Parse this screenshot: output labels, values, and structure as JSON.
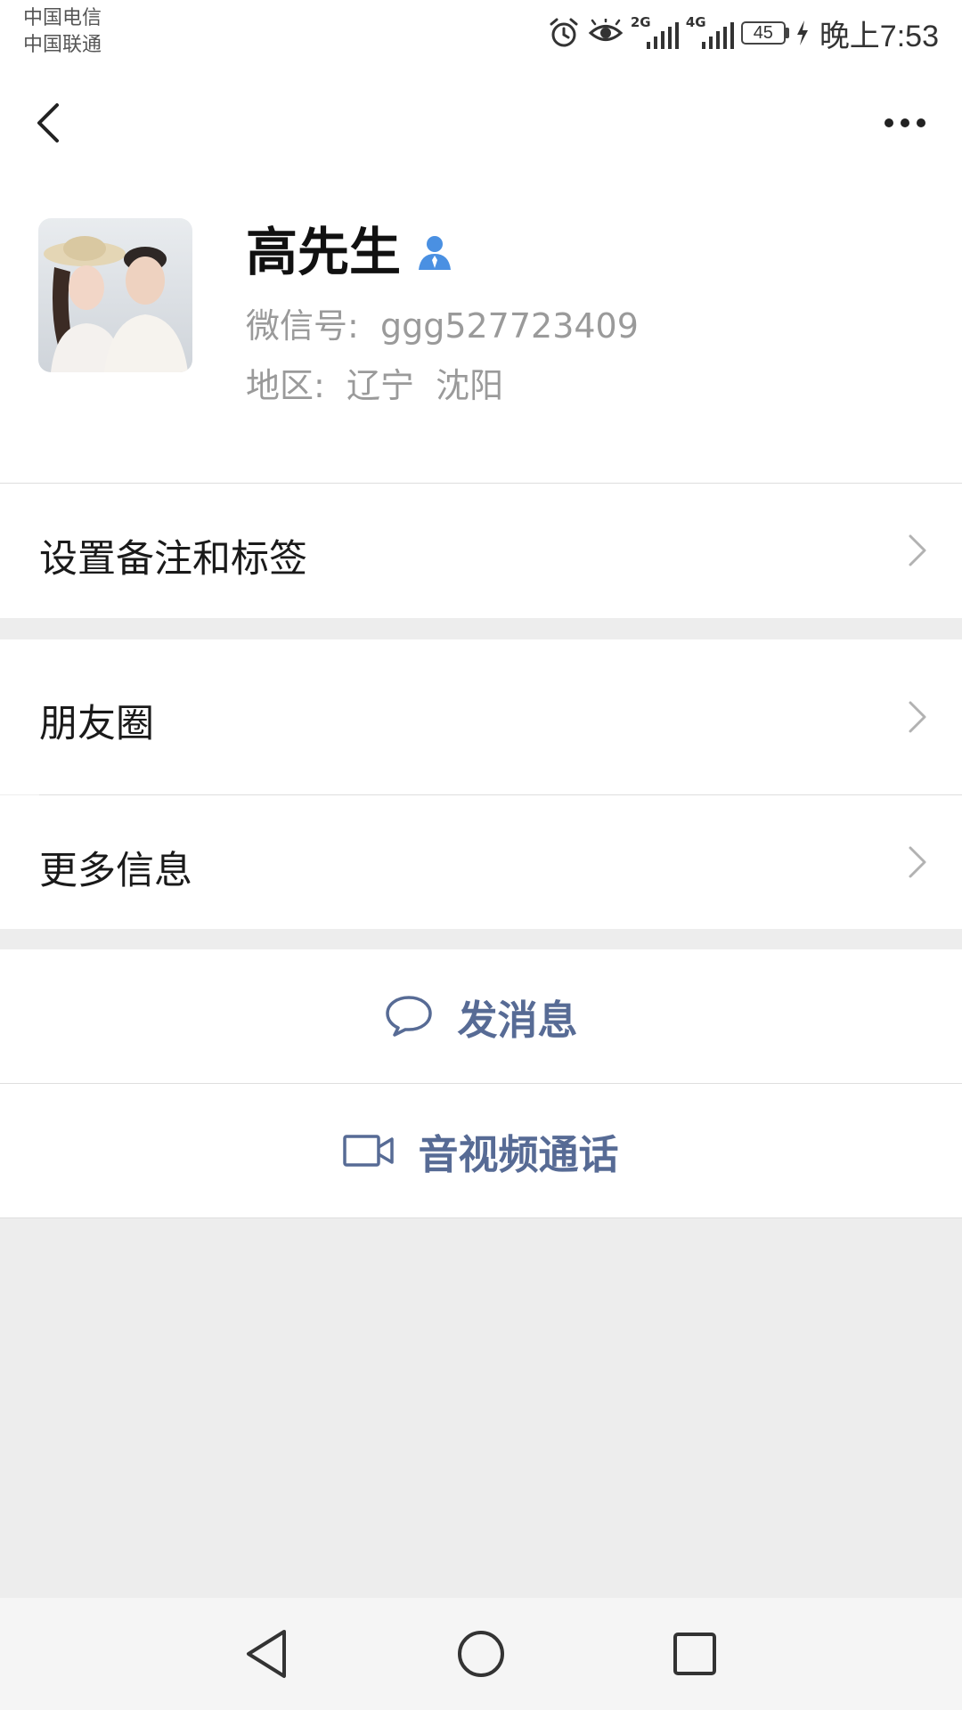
{
  "status_bar": {
    "carrier_1": "中国电信",
    "carrier_2": "中国联通",
    "signal_1_type": "2G",
    "signal_2_type": "4G",
    "battery_level": "45",
    "time": "晚上7:53",
    "icons": [
      "alarm-icon",
      "eye-icon",
      "signal-icon",
      "signal-icon",
      "battery-icon",
      "charging-icon"
    ]
  },
  "nav": {
    "back_icon": "back-arrow-icon",
    "more_icon": "more-dots-icon"
  },
  "profile": {
    "name": "高先生",
    "wechat_id_text": "微信号:  ggg527723409",
    "region_text": "地区:  辽宁  沈阳",
    "badge_icon": "person-icon",
    "badge_color": "#4a90e2"
  },
  "rows": {
    "remark": "设置备注和标签",
    "moments": "朋友圈",
    "more_info": "更多信息"
  },
  "actions": {
    "message": "发消息",
    "video_call": "音视频通话",
    "accent_color": "#576b95"
  }
}
